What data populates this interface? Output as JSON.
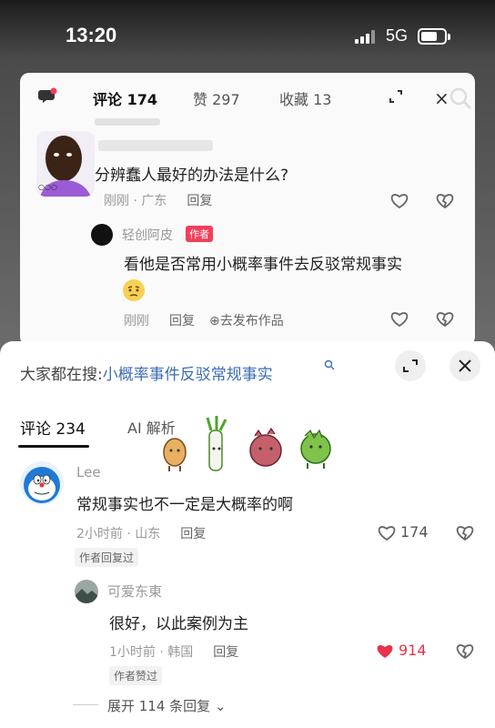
{
  "status_bar": {
    "time": "13:20",
    "network": "5G",
    "battery_level": 0.6
  },
  "back_panel": {
    "tabs": {
      "comments": "评论 174",
      "likes": "赞 297",
      "saves": "收藏 13"
    },
    "question": {
      "text": "分辨蠢人最好的办法是什么?",
      "time": "刚刚 · 广东",
      "reply_label": "回复"
    },
    "author_reply": {
      "name": "轻创阿皮",
      "badge": "作者",
      "text": "看他是否常用小概率事件去反驳常规事实",
      "time": "刚刚",
      "reply_label": "回复",
      "post_label": "去发布作品"
    }
  },
  "sheet": {
    "search_prefix": "大家都在搜:",
    "search_query": "小概率事件反驳常规事实",
    "tabs": {
      "comments": "评论 234",
      "ai": "AI 解析"
    },
    "comment": {
      "user": "Lee",
      "text": "常规事实也不一定是大概率的啊",
      "time": "2小时前 · 山东",
      "reply_label": "回复",
      "likes": "174",
      "tag": "作者回复过"
    },
    "sub_comment": {
      "user": "可爱东東",
      "text": "很好，以此案例为主",
      "time": "1小时前 · 韩国",
      "reply_label": "回复",
      "likes": "914",
      "tag": "作者赞过"
    },
    "expand_label": "展开 114 条回复"
  },
  "colors": {
    "accent_link": "#3c6cb4",
    "liked_heart": "#e8334a",
    "author_badge": "#f23f5b"
  },
  "icons": [
    "signal-icon",
    "battery-icon",
    "chat-bubble-icon",
    "expand-icon",
    "close-icon",
    "search-icon",
    "heart-icon",
    "broken-heart-icon",
    "chevron-down-icon"
  ]
}
